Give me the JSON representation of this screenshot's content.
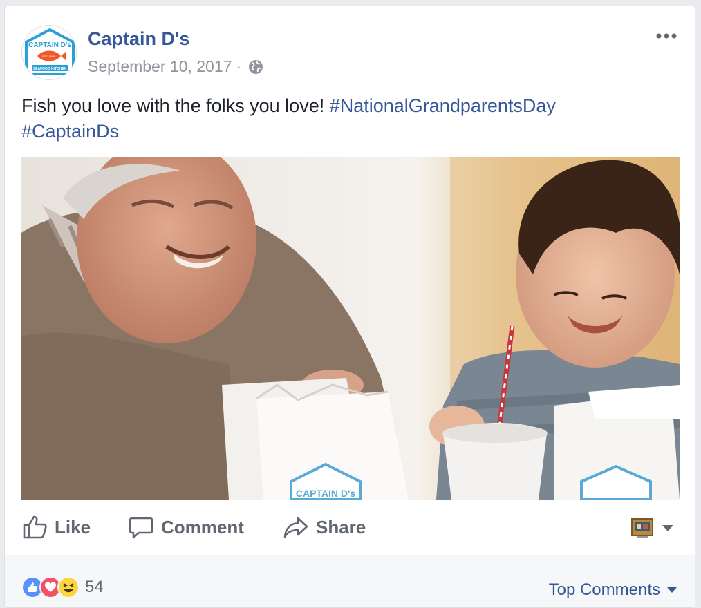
{
  "post": {
    "page_name": "Captain D's",
    "date": "September 10, 2017",
    "separator": "·",
    "privacy_icon": "globe-icon",
    "text_plain": "Fish you love with the folks you love! ",
    "hashtags": [
      "#NationalGrandparentsDay",
      "#CaptainDs"
    ],
    "logo_text": "CAPTAIN D's",
    "logo_subtext": "SEAFOOD KITCHEN",
    "logo_est": "EST. 1969",
    "bag_text": "CAPTAIN D's"
  },
  "actions": {
    "like": "Like",
    "comment": "Comment",
    "share": "Share"
  },
  "footer": {
    "reaction_icons": [
      "like-reaction-icon",
      "love-reaction-icon",
      "haha-reaction-icon"
    ],
    "reaction_count": "54",
    "sort_label": "Top Comments"
  },
  "colors": {
    "link": "#365899",
    "like_blue": "#5890ff",
    "love_red": "#f25268",
    "haha_yellow": "#fcd63f",
    "logo_blue": "#2a9fd8",
    "logo_orange": "#f05a28"
  }
}
